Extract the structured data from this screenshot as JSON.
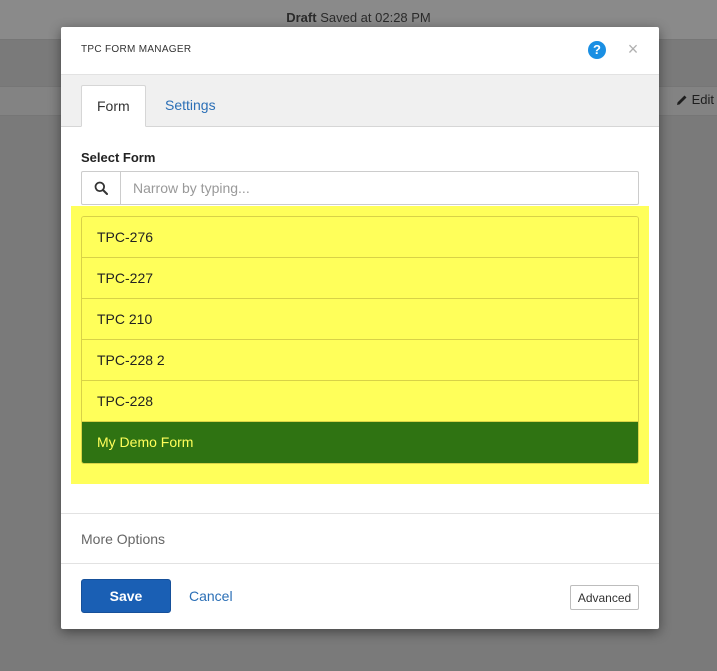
{
  "background": {
    "status_bold": "Draft",
    "status_text": " Saved at 02:28 PM",
    "edit_label": "Edit"
  },
  "modal": {
    "title": "TPC FORM MANAGER",
    "help_icon": "?",
    "close_icon": "×"
  },
  "tabs": [
    {
      "label": "Form",
      "active": true
    },
    {
      "label": "Settings",
      "active": false
    }
  ],
  "form": {
    "select_label": "Select Form",
    "search_placeholder": "Narrow by typing...",
    "items": [
      {
        "label": "TPC-276",
        "selected": false
      },
      {
        "label": "TPC-227",
        "selected": false
      },
      {
        "label": "TPC 210",
        "selected": false
      },
      {
        "label": "TPC-228 2",
        "selected": false
      },
      {
        "label": "TPC-228",
        "selected": false
      },
      {
        "label": "My Demo Form",
        "selected": true
      }
    ]
  },
  "more_options_label": "More Options",
  "footer": {
    "save_label": "Save",
    "cancel_label": "Cancel",
    "advanced_label": "Advanced"
  },
  "colors": {
    "highlight": "#ffff5a",
    "selected_bg": "#2f7312",
    "primary": "#1a5fb4",
    "link": "#2b6fb6",
    "help": "#1a8fe3"
  }
}
